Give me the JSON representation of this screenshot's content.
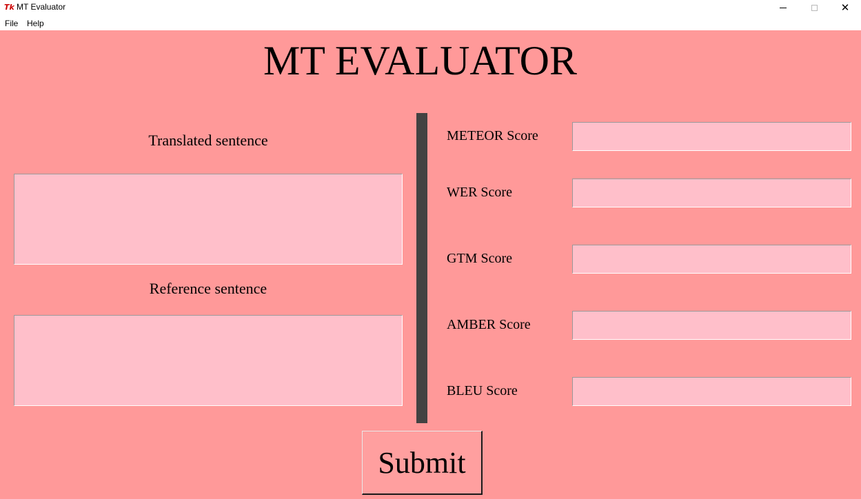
{
  "window": {
    "title": "MT Evaluator",
    "icon": "tk-feather-icon",
    "close_glyph": "✕"
  },
  "menu": {
    "file": "File",
    "help": "Help"
  },
  "main": {
    "title": "MT EVALUATOR",
    "translated_label": "Translated sentence",
    "translated_value": "",
    "reference_label": "Reference sentence",
    "reference_value": "",
    "submit_label": "Submit"
  },
  "scores": {
    "meteor": {
      "label": "METEOR Score",
      "value": ""
    },
    "wer": {
      "label": "WER Score",
      "value": ""
    },
    "gtm": {
      "label": "GTM Score",
      "value": ""
    },
    "amber": {
      "label": "AMBER Score",
      "value": ""
    },
    "bleu": {
      "label": "BLEU Score",
      "value": ""
    }
  },
  "colors": {
    "background": "#ff9999",
    "field_background": "#ffbfca",
    "divider": "#424242",
    "button_background": "#ff9f9f"
  }
}
